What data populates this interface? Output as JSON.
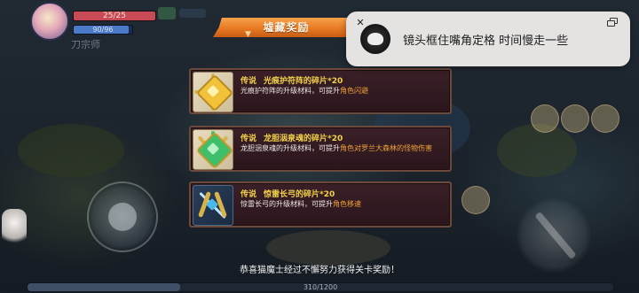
{
  "hud": {
    "hp": {
      "text": "25/25",
      "fraction": 1.0
    },
    "mp": {
      "text": "90/96",
      "fraction": 0.94
    },
    "player_name": "刀宗师"
  },
  "reward_panel": {
    "title": "墟藏奖励",
    "items": [
      {
        "rarity": "传说",
        "name": "光痕护符阵的碎片*20",
        "desc_prefix": "光痕护符阵的升级材料，可提升",
        "desc_highlight": "角色闪避",
        "icon": "golden-amulet-shard-icon",
        "accent": "#f2c23a"
      },
      {
        "rarity": "传说",
        "name": "龙胆洇泉魂的碎片*20",
        "desc_prefix": "龙胆洇泉魂的升级材料，可提升",
        "desc_highlight": "角色对罗兰大森林的怪物伤害",
        "icon": "green-dragon-soul-shard-icon",
        "accent": "#3fbf6a"
      },
      {
        "rarity": "传说",
        "name": "惊雷长弓的碎片*20",
        "desc_prefix": "惊雷长弓的升级材料，可提升",
        "desc_highlight": "角色移速",
        "icon": "thunder-longbow-shard-icon",
        "accent": "#4ab8e8"
      }
    ]
  },
  "notification": {
    "message": "镜头框住嘴角定格 时间慢走一些",
    "close_icon": "close-icon",
    "expand_icon": "expand-window-icon"
  },
  "bottom_message": "恭喜猫魔士经过不懈努力获得关卡奖励！",
  "xp": {
    "text": "310/1200",
    "fraction": 0.26
  },
  "colors": {
    "rarity": "#f2d14a",
    "highlight": "#f0a23a",
    "banner": "#e77a22",
    "card_border": "#6b4a3c"
  }
}
